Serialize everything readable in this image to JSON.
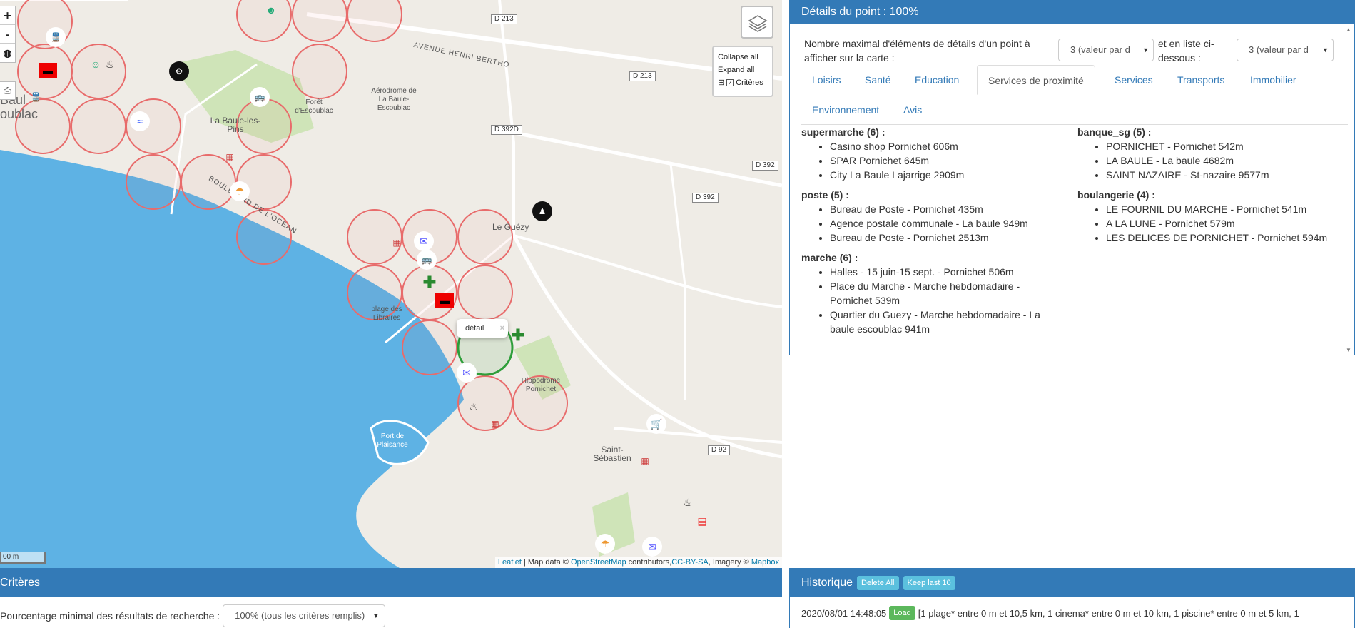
{
  "map": {
    "zoom_in": "+",
    "zoom_out": "-",
    "collapse_all": "Collapse all",
    "expand_all": "Expand all",
    "criteres_toggle": "Critères",
    "scale": "00 m",
    "attribution": {
      "leaflet": "Leaflet",
      "mapdata": " | Map data © ",
      "osm": "OpenStreetMap",
      "contributors": " contributors,",
      "ccbysa": "CC-BY-SA",
      "imagery": ", Imagery © ",
      "mapbox": "Mapbox"
    },
    "popup_label": "détail",
    "popup_close": "×",
    "place_labels": {
      "baule": "Baul",
      "escoublac": "oublac",
      "la_baule_pins": "La Baule-les-\nPins",
      "foret": "Forêt\nd'Escoublac",
      "aerodrome": "Aérodrome de\nLa Baule-\nEscoublac",
      "avenue": "AVENUE HENRI BERTHO",
      "boulevard": "BOULEVARD DE L'OCEAN",
      "le_guezy": "Le Guézy",
      "plage": "plage des\nLibraires",
      "hippodrome": "Hippodrome\nPornichet",
      "port": "Port de\nPlaisance",
      "saint_sebastien": "Saint-\nSébastien"
    },
    "road_labels": [
      "D 213",
      "D 213",
      "D 392D",
      "D 392",
      "D 392",
      "D 92"
    ],
    "colors": {
      "sea": "#5eb2e4",
      "land": "#efece6",
      "circle_red": "#e86b6b",
      "circle_green": "#2e9e3a"
    }
  },
  "details": {
    "title": "Détails du point : 100%",
    "max_label": "Nombre maximal d'éléments de détails d'un point à afficher sur la carte :",
    "max_select": "3 (valeur par d",
    "list_label": "et en liste ci-dessous :",
    "list_select": "3 (valeur par d",
    "tabs": [
      "Loisirs",
      "Santé",
      "Education",
      "Services de proximité",
      "Services",
      "Transports",
      "Immobilier",
      "Environnement",
      "Avis"
    ],
    "active_tab": "Services de proximité",
    "left_column": [
      {
        "title": "supermarche (6) :",
        "items": [
          "Casino shop Pornichet 606m",
          "SPAR Pornichet 645m",
          "City La Baule Lajarrige 2909m"
        ]
      },
      {
        "title": "poste (5) :",
        "items": [
          "Bureau de Poste - Pornichet 435m",
          "Agence postale communale - La baule 949m",
          "Bureau de Poste - Pornichet 2513m"
        ]
      },
      {
        "title": "marche (6) :",
        "items": [
          "Halles - 15 juin-15 sept. - Pornichet 506m",
          "Place du Marche - Marche hebdomadaire - Pornichet 539m",
          "Quartier du Guezy - Marche hebdomadaire - La baule escoublac 941m"
        ]
      }
    ],
    "right_column": [
      {
        "title": "banque_sg (5) :",
        "items": [
          "PORNICHET - Pornichet 542m",
          "LA BAULE - La baule 4682m",
          "SAINT NAZAIRE - St-nazaire 9577m"
        ]
      },
      {
        "title": "boulangerie (4) :",
        "items": [
          "LE FOURNIL DU MARCHE - Pornichet 541m",
          "A LA LUNE - Pornichet 579m",
          "LES DELICES DE PORNICHET - Pornichet 594m"
        ]
      }
    ]
  },
  "criteres": {
    "title": "Critères",
    "pct_label": "Pourcentage minimal des résultats de recherche :",
    "pct_select": "100% (tous les critères remplis)"
  },
  "historique": {
    "title": "Historique",
    "delete_all": "Delete All",
    "keep_last": "Keep last 10",
    "entry_date": "2020/08/01 14:48:05",
    "load": "Load",
    "entry_text": "[1 plage* entre 0 m et 10,5 km, 1 cinema* entre 0 m et 10 km, 1 piscine* entre 0 m et 5 km, 1"
  }
}
